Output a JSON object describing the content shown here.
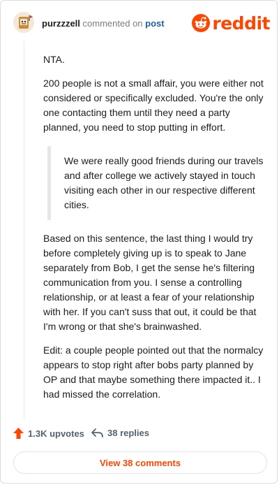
{
  "comment": {
    "username": "purzzzell",
    "action_text": "commented on",
    "target_text": "post",
    "brand": "reddit",
    "paragraphs": [
      "NTA.",
      "200 people is not a small affair, you were either not considered or specifically excluded. You're the only one contacting them until they need a party planned, you need to stop putting in effort."
    ],
    "quote": "We were really good friends during our travels and after college we actively stayed in touch visiting each other in our respective different cities.",
    "paragraphs_after": [
      "Based on this sentence, the last thing I would try before completely giving up is to speak to Jane separately from Bob, I get the sense he's filtering communication from you. I sense a controlling relationship, or at least a fear of your relationship with her. If you can't suss that out, it could be that I'm wrong or that she's brainwashed.",
      "Edit: a couple people pointed out that the normalcy appears to stop right after bobs party planned by OP and that maybe something there impacted it.. I had missed the correlation."
    ]
  },
  "footer": {
    "upvotes_label": "1.3K upvotes",
    "replies_label": "38 replies",
    "view_comments_label": "View 38 comments"
  },
  "icons": {
    "upvote": "upvote-arrow-icon",
    "reply": "reply-arrow-icon",
    "avatar": "avatar",
    "logo": "reddit-logo-icon"
  },
  "colors": {
    "brand": "#ff4500",
    "link": "#1f5fa8",
    "muted": "#7c7c7c"
  }
}
